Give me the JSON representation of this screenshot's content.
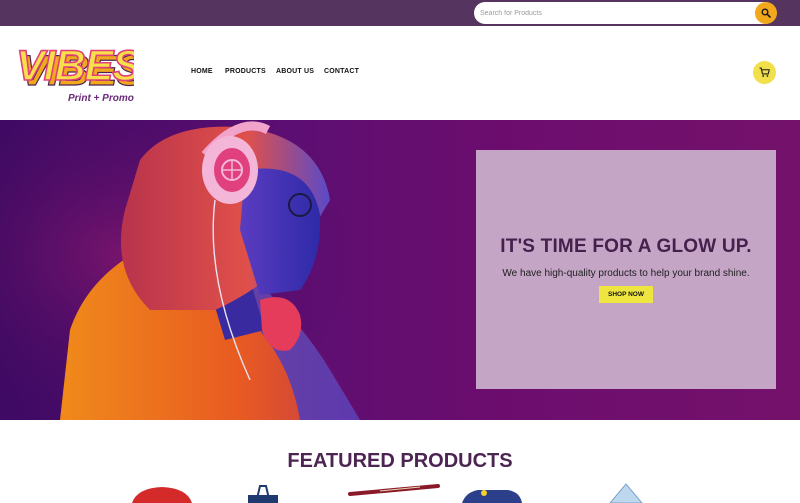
{
  "search": {
    "placeholder": "Search for Products"
  },
  "logo": {
    "word": "VIBES",
    "tagline": "Print + Promo"
  },
  "nav": {
    "items": [
      "HOME",
      "PRODUCTS",
      "ABOUT US",
      "CONTACT"
    ]
  },
  "hero": {
    "headline": "IT'S TIME FOR A GLOW UP.",
    "subtext": "We have high-quality products to help your brand shine.",
    "cta": "SHOP NOW"
  },
  "featured": {
    "title": "FEATURED PRODUCTS"
  },
  "colors": {
    "topbar": "#55345f",
    "accent_yellow": "#f1e04b",
    "accent_orange": "#f2a81d",
    "brand_purple": "#4c2552",
    "promo_box": "#c4a5c6"
  },
  "icons": [
    "search-icon",
    "cart-icon"
  ]
}
